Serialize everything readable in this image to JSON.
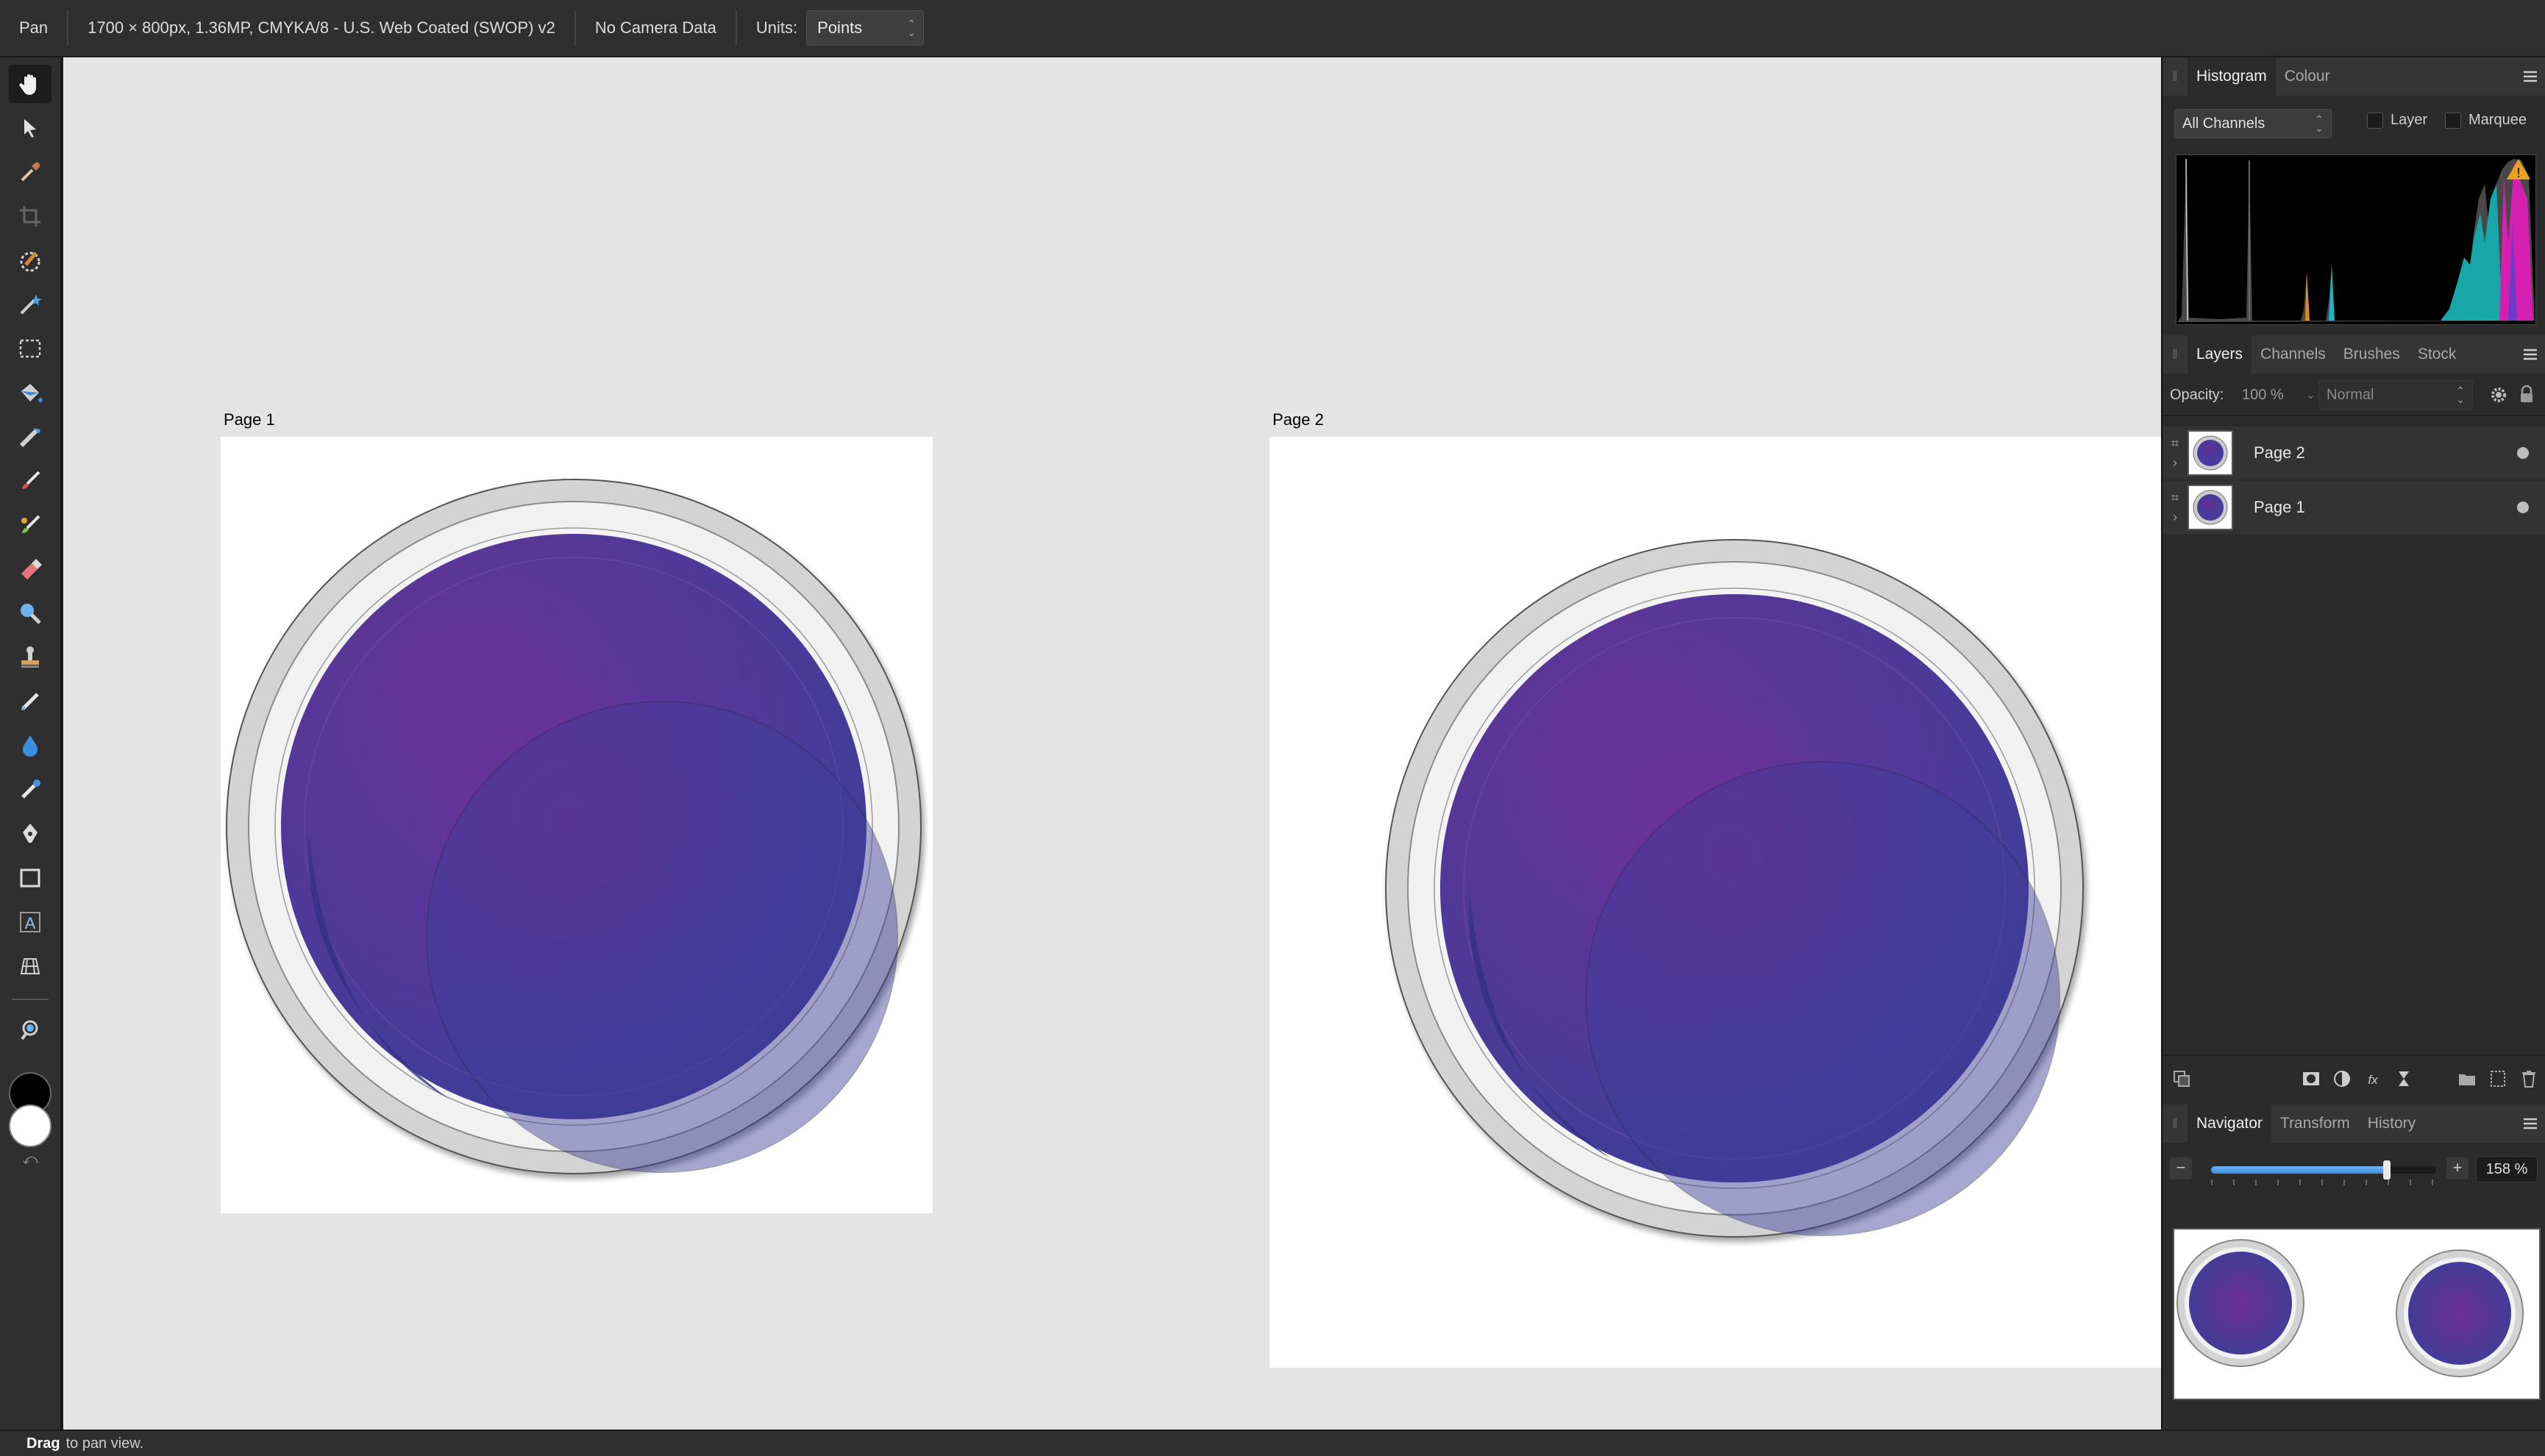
{
  "context_bar": {
    "tool_name": "Pan",
    "document_info": "1700 × 800px, 1.36MP, CMYKA/8 - U.S. Web Coated (SWOP) v2",
    "camera_info": "No Camera Data",
    "units_label": "Units:",
    "units_value": "Points"
  },
  "tools": [
    {
      "name": "view-tool",
      "icon": "hand-icon",
      "active": true
    },
    {
      "name": "move-tool",
      "icon": "pointer-icon"
    },
    {
      "name": "colour-picker-tool",
      "icon": "eyedropper-icon"
    },
    {
      "name": "crop-tool",
      "icon": "crop-icon"
    },
    {
      "name": "selection-brush-tool",
      "icon": "selection-brush-icon"
    },
    {
      "name": "flood-select-tool",
      "icon": "magic-wand-icon"
    },
    {
      "name": "rectangular-marquee-tool",
      "icon": "marquee-icon"
    },
    {
      "name": "flood-fill-tool",
      "icon": "paint-bucket-icon"
    },
    {
      "name": "gradient-tool",
      "icon": "gradient-icon"
    },
    {
      "name": "paint-brush-tool",
      "icon": "brush-icon"
    },
    {
      "name": "paint-mixer-tool",
      "icon": "mixer-brush-icon"
    },
    {
      "name": "erase-brush-tool",
      "icon": "eraser-icon"
    },
    {
      "name": "dodge-tool",
      "icon": "dodge-icon"
    },
    {
      "name": "clone-brush-tool",
      "icon": "clone-stamp-icon"
    },
    {
      "name": "healing-brush-tool",
      "icon": "healing-icon"
    },
    {
      "name": "blur-brush-tool",
      "icon": "blur-drop-icon"
    },
    {
      "name": "red-eye-tool",
      "icon": "red-eye-icon"
    },
    {
      "name": "pen-tool",
      "icon": "pen-icon"
    },
    {
      "name": "rectangle-tool",
      "icon": "rectangle-icon"
    },
    {
      "name": "artistic-text-tool",
      "icon": "text-icon"
    },
    {
      "name": "mesh-warp-tool",
      "icon": "mesh-warp-icon"
    },
    {
      "name": "zoom-tool",
      "icon": "zoom-icon"
    }
  ],
  "colors": {
    "primary": "#000000",
    "secondary": "#ffffff",
    "canvas_bg": "#e4e4e4",
    "lens_purple": "#4b3a9c",
    "lens_magenta": "#7a2e95"
  },
  "canvas": {
    "pages": [
      {
        "label": "Page 1"
      },
      {
        "label": "Page 2"
      }
    ]
  },
  "histogram_panel": {
    "tabs": [
      "Histogram",
      "Colour"
    ],
    "active_tab": "Histogram",
    "channel_select": "All Channels",
    "layer_checkbox": "Layer",
    "marquee_checkbox": "Marquee",
    "warning_icon": "clipping-warning-icon"
  },
  "layers_panel": {
    "tabs": [
      "Layers",
      "Channels",
      "Brushes",
      "Stock"
    ],
    "active_tab": "Layers",
    "opacity_label": "Opacity:",
    "opacity_value": "100 %",
    "blend_mode": "Normal",
    "layers": [
      {
        "name": "Page 2",
        "visible": true
      },
      {
        "name": "Page 1",
        "visible": true
      }
    ]
  },
  "navigator_panel": {
    "tabs": [
      "Navigator",
      "Transform",
      "History"
    ],
    "active_tab": "Navigator",
    "zoom_value": "158 %",
    "zoom_minus": "−",
    "zoom_plus": "+",
    "zoom_level": 0.78
  },
  "status_bar": {
    "action": "Drag",
    "hint": "to pan view."
  }
}
